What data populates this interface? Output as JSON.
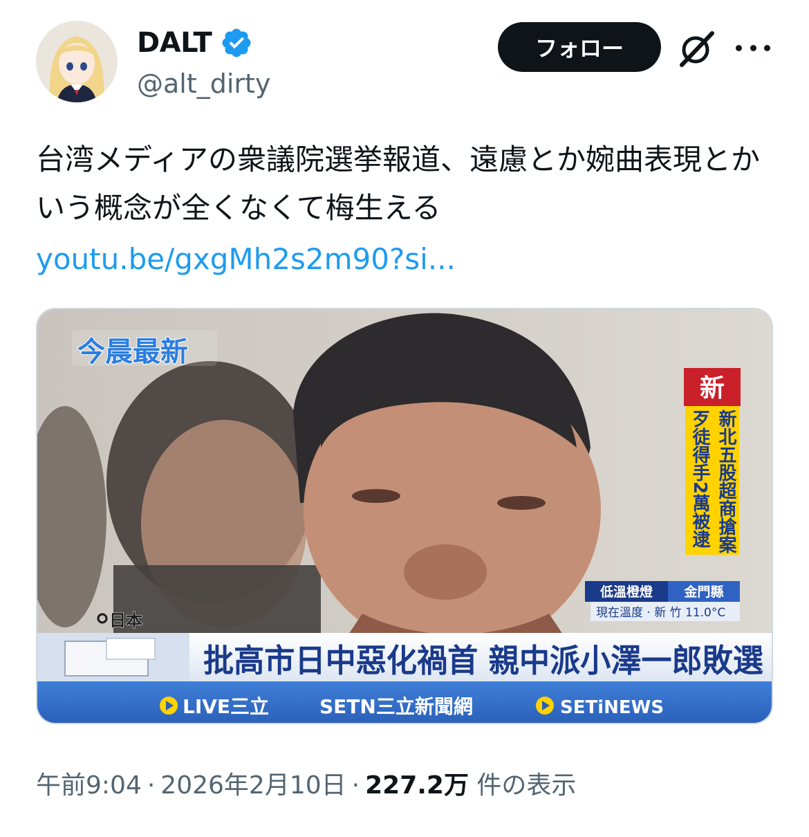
{
  "author": {
    "display_name": "DALT",
    "handle": "@alt_dirty",
    "verified": true
  },
  "actions": {
    "follow_label": "フォロー"
  },
  "tweet": {
    "text": "台湾メディアの衆議院選挙報道、遠慮とか婉曲表現とかいう概念が全くなくて梅生える",
    "link": "youtu.be/gxgMh2s2m90?si..."
  },
  "media": {
    "program_logo": "今晨最新",
    "location": "日本",
    "headline": "批高市日中惡化禍首 親中派小澤一郎敗選",
    "side_badge": "新",
    "side_ticker_line1": "新北五股超商搶案",
    "side_ticker_line2": "歹徒得手2萬被逮",
    "weather_alert": "低溫橙燈",
    "weather_place": "金門縣",
    "weather_temp": "現在溫度 · 新 竹 11.0°C",
    "brand_live": "LIVE三立",
    "brand_setn": "SETN三立新聞網",
    "brand_inews": "SETiNEWS"
  },
  "meta": {
    "time": "午前9:04",
    "date": "2026年2月10日",
    "views": "227.2万",
    "views_suffix": "件の表示"
  },
  "colors": {
    "accent_blue": "#1d9bf0",
    "text_primary": "#0f1419",
    "text_secondary": "#536471",
    "verified": "#1d9bf0"
  }
}
